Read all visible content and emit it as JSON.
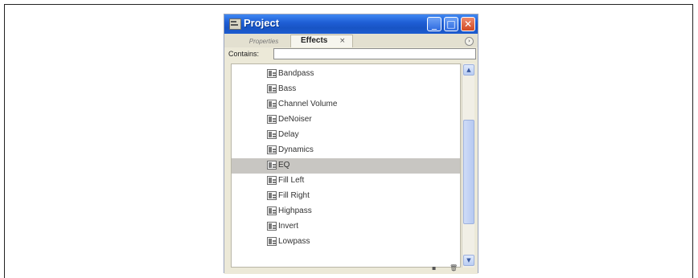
{
  "window": {
    "title": "Project",
    "controls": {
      "minimize": "_",
      "maximize": "□",
      "close": "✕"
    }
  },
  "tabs": {
    "inactive": "Properties",
    "active": "Effects",
    "active_close": "×",
    "menu_icon": "›"
  },
  "filter": {
    "label": "Contains:",
    "value": ""
  },
  "effects": [
    {
      "label": "Bandpass",
      "selected": false
    },
    {
      "label": "Bass",
      "selected": false
    },
    {
      "label": "Channel Volume",
      "selected": false
    },
    {
      "label": "DeNoiser",
      "selected": false
    },
    {
      "label": "Delay",
      "selected": false
    },
    {
      "label": "Dynamics",
      "selected": false
    },
    {
      "label": "EQ",
      "selected": true
    },
    {
      "label": "Fill Left",
      "selected": false
    },
    {
      "label": "Fill Right",
      "selected": false
    },
    {
      "label": "Highpass",
      "selected": false
    },
    {
      "label": "Invert",
      "selected": false
    },
    {
      "label": "Lowpass",
      "selected": false
    }
  ],
  "scroll": {
    "up": "▲",
    "down": "▼"
  },
  "status_icons": {
    "new_bin": "▪",
    "delete": "🗑"
  }
}
